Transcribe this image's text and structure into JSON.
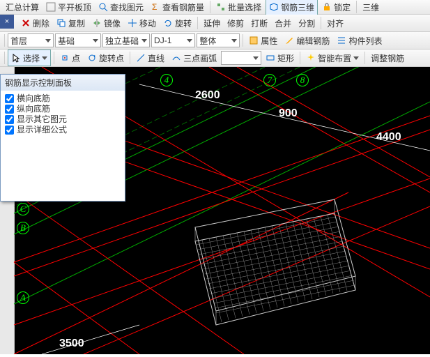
{
  "toolbars": {
    "row1": {
      "calc": "汇总计算",
      "check": "平开板顶",
      "view": "查找图元",
      "rebar": "查看钢筋量",
      "batch": "批量选择",
      "three_d": "钢筋三维",
      "lock": "锁定",
      "view3d": "三维"
    },
    "row2": {
      "delete": "删除",
      "copy": "复制",
      "mirror": "镜像",
      "move": "移动",
      "rotate": "旋转",
      "extend": "延伸",
      "trim": "修剪",
      "break": "打断",
      "merge": "合并",
      "split": "分割",
      "align": "对齐"
    },
    "row3": {
      "floor": "首层",
      "category": "基础",
      "subcat": "独立基础",
      "item": "DJ-1",
      "whole": "整体",
      "props": "属性",
      "edit_rebar": "编辑钢筋",
      "comp_list": "构件列表"
    },
    "row4": {
      "select": "选择",
      "point": "点",
      "rot_pt": "旋转点",
      "line": "直线",
      "arc3": "三点画弧",
      "rect": "矩形",
      "smart": "智能布置",
      "adjust": "调整钢筋"
    }
  },
  "panel": {
    "title": "钢筋显示控制面板",
    "options": [
      "横向底筋",
      "纵向底筋",
      "显示其它图元",
      "显示详细公式"
    ]
  },
  "dims": {
    "d1": "2600",
    "d2": "900",
    "d3": "4400",
    "d4": "3500"
  },
  "grids": {
    "g4": "4",
    "g7": "7",
    "g8": "8",
    "gA": "A",
    "gB": "B",
    "gC": "C"
  },
  "close": "×"
}
